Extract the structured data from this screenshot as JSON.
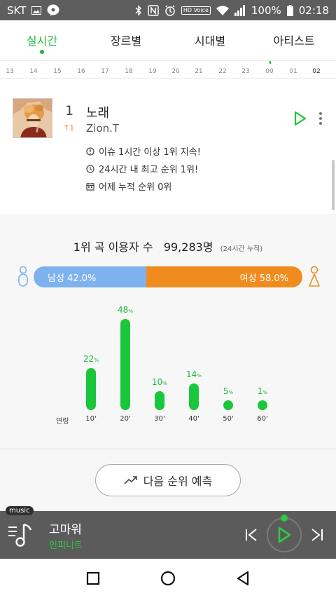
{
  "status": {
    "carrier": "SKT",
    "battery": "100%",
    "time": "02:18",
    "hd_badge": "HD Voice"
  },
  "tabs": [
    {
      "label": "실시간"
    },
    {
      "label": "장르별"
    },
    {
      "label": "시대별"
    },
    {
      "label": "아티스트"
    }
  ],
  "hours": [
    "13",
    "14",
    "15",
    "16",
    "17",
    "18",
    "19",
    "20",
    "21",
    "22",
    "23",
    "00",
    "01",
    "02"
  ],
  "song": {
    "rank": "1",
    "rank_change": "↑1",
    "title": "노래",
    "artist": "Zion.T",
    "info": [
      "이슈 1시간 이상 1위 지속!",
      "24시간 내 최고 순위 1위!",
      "어제 누적 순위 0위"
    ]
  },
  "stats": {
    "users_label": "1위 곡 이용자 수",
    "users_count": "99,283명",
    "users_period": "(24시간 누적)",
    "male_label": "남성 42.0%",
    "male_share": 42.0,
    "female_label": "여성 58.0%",
    "female_share": 58.0,
    "age_header": "연령",
    "ages": [
      {
        "label": "10'",
        "value": 22,
        "pct": "22",
        "unit": "%"
      },
      {
        "label": "20'",
        "value": 48,
        "pct": "48",
        "unit": "%"
      },
      {
        "label": "30'",
        "value": 10,
        "pct": "10",
        "unit": "%"
      },
      {
        "label": "40'",
        "value": 14,
        "pct": "14",
        "unit": "%"
      },
      {
        "label": "50'",
        "value": 5,
        "pct": "5",
        "unit": "%"
      },
      {
        "label": "60'",
        "value": 1,
        "pct": "1",
        "unit": "%"
      }
    ],
    "predict_label": "다음 순위 예측"
  },
  "player": {
    "badge": "music",
    "title": "고마워",
    "artist": "인피니트"
  },
  "colors": {
    "accent": "#1db93b",
    "male": "#7eb2ee",
    "female": "#f08c1e",
    "up": "#f08c1e"
  }
}
